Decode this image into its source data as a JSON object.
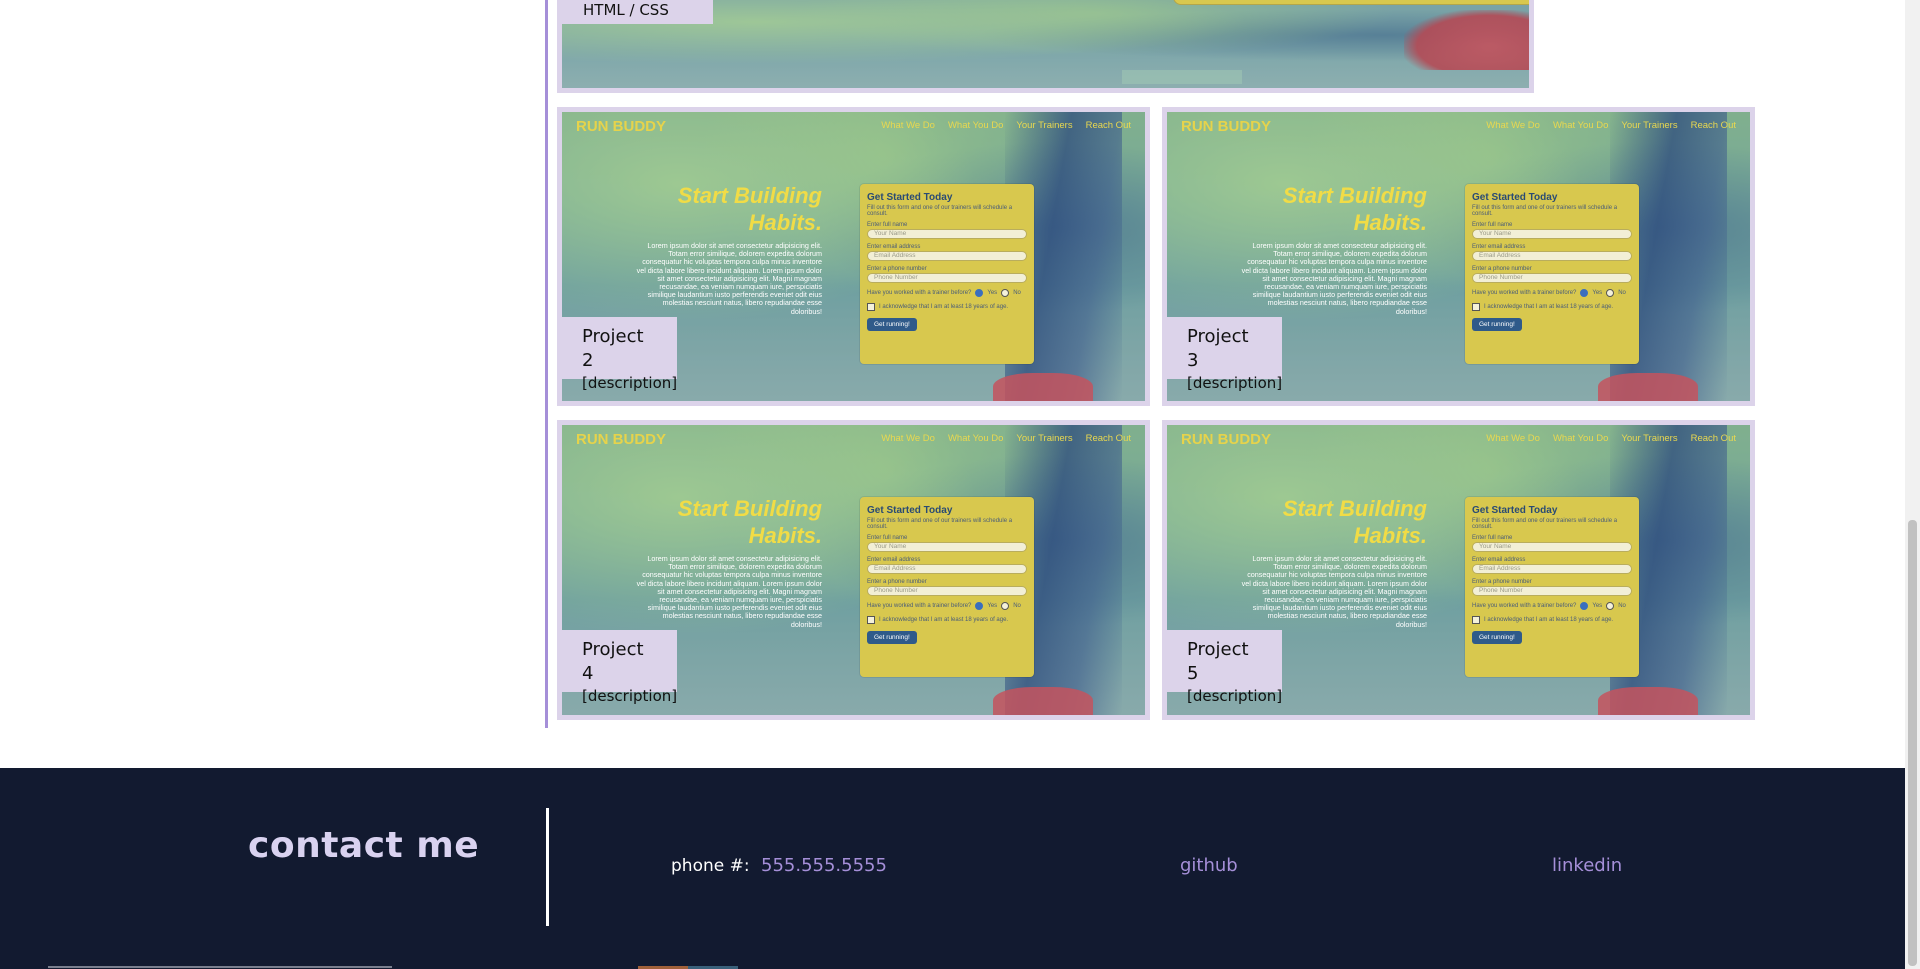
{
  "work": {
    "top_card": {
      "caption": "HTML / CSS"
    },
    "projects": [
      {
        "title": "Project 2",
        "description": "[description]"
      },
      {
        "title": "Project 3",
        "description": "[description]"
      },
      {
        "title": "Project 4",
        "description": "[description]"
      },
      {
        "title": "Project 5",
        "description": "[description]"
      }
    ],
    "screenshot": {
      "logo": "RUN BUDDY",
      "nav": [
        "What We Do",
        "What You Do",
        "Your Trainers",
        "Reach Out"
      ],
      "hero_title": "Start Building Habits.",
      "hero_text": "Lorem ipsum dolor sit amet consectetur adipisicing elit. Totam error similique, dolorem expedita dolorum consequatur hic voluptas tempora culpa minus inventore vel dicta labore libero incidunt aliquam. Lorem ipsum dolor sit amet consectetur adipisicing elit. Magni magnam recusandae, ea veniam numquam iure, perspiciatis similique laudantium iusto perferendis eveniet odit eius molestias nesciunt natus, libero repudiandae esse doloribus!",
      "form_title": "Get Started Today",
      "form_subtitle": "Fill out this form and one of our trainers will schedule a consult.",
      "name_label": "Enter full name",
      "name_placeholder": "Your Name",
      "email_label": "Enter email address",
      "email_placeholder": "Email Address",
      "phone_label": "Enter a phone number",
      "phone_placeholder": "Phone Number",
      "trainer_question": "Have you worked with a trainer before?",
      "yes": "Yes",
      "no": "No",
      "acknowledge": "I acknowledge that I am at least 18 years of age.",
      "submit": "Get running!"
    }
  },
  "footer": {
    "heading": "contact me",
    "phone_label": "phone #:",
    "phone_value": "555.555.5555",
    "github": "github",
    "linkedin": "linkedin"
  },
  "colors": {
    "accent": "#a58fd8",
    "footer_bg": "#121a30",
    "card_bg": "#dcd3ea",
    "brand_yellow": "#e6d34b"
  }
}
